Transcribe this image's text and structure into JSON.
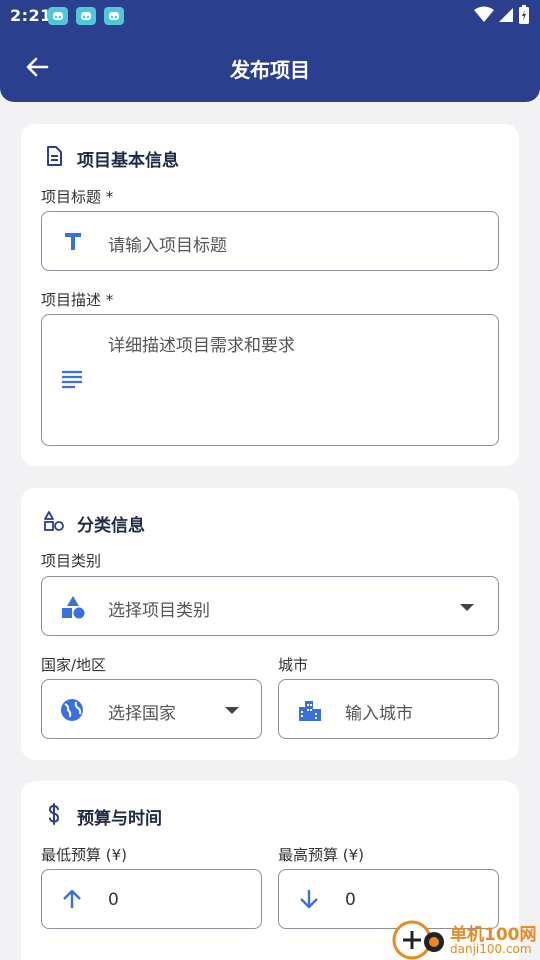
{
  "status_bar": {
    "time": "2:21",
    "notification_icons": [
      "app-notification-icon",
      "app-notification-icon",
      "app-notification-icon"
    ],
    "right_icons": [
      "wifi-icon",
      "cell-signal-icon",
      "battery-icon"
    ]
  },
  "app_bar": {
    "back_icon": "arrow-back-icon",
    "title": "发布项目"
  },
  "basic_info": {
    "icon": "document-icon",
    "title": "项目基本信息",
    "title_field": {
      "label": "项目标题 *",
      "icon": "text-format-icon",
      "placeholder": "请输入项目标题"
    },
    "description_field": {
      "label": "项目描述 *",
      "icon": "notes-icon",
      "placeholder": "详细描述项目需求和要求"
    }
  },
  "category_info": {
    "icon": "category-icon",
    "title": "分类信息",
    "category_field": {
      "label": "项目类别",
      "icon": "category-filled-icon",
      "placeholder": "选择项目类别"
    },
    "country_field": {
      "label": "国家/地区",
      "icon": "globe-icon",
      "placeholder": "选择国家"
    },
    "city_field": {
      "label": "城市",
      "icon": "city-icon",
      "placeholder": "输入城市"
    }
  },
  "budget_info": {
    "icon": "dollar-icon",
    "title": "预算与时间",
    "min_budget": {
      "label": "最低预算 (¥)",
      "icon": "arrow-up-icon",
      "value": "0"
    },
    "max_budget": {
      "label": "最高预算 (¥)",
      "icon": "arrow-down-icon",
      "value": "0"
    }
  },
  "watermark": {
    "line1": "单机100网",
    "line2": "danji100.com"
  },
  "colors": {
    "primary": "#2b3f8f",
    "accent_icon": "#3a6fe0",
    "background": "#f2f2f4",
    "card": "#ffffff"
  }
}
